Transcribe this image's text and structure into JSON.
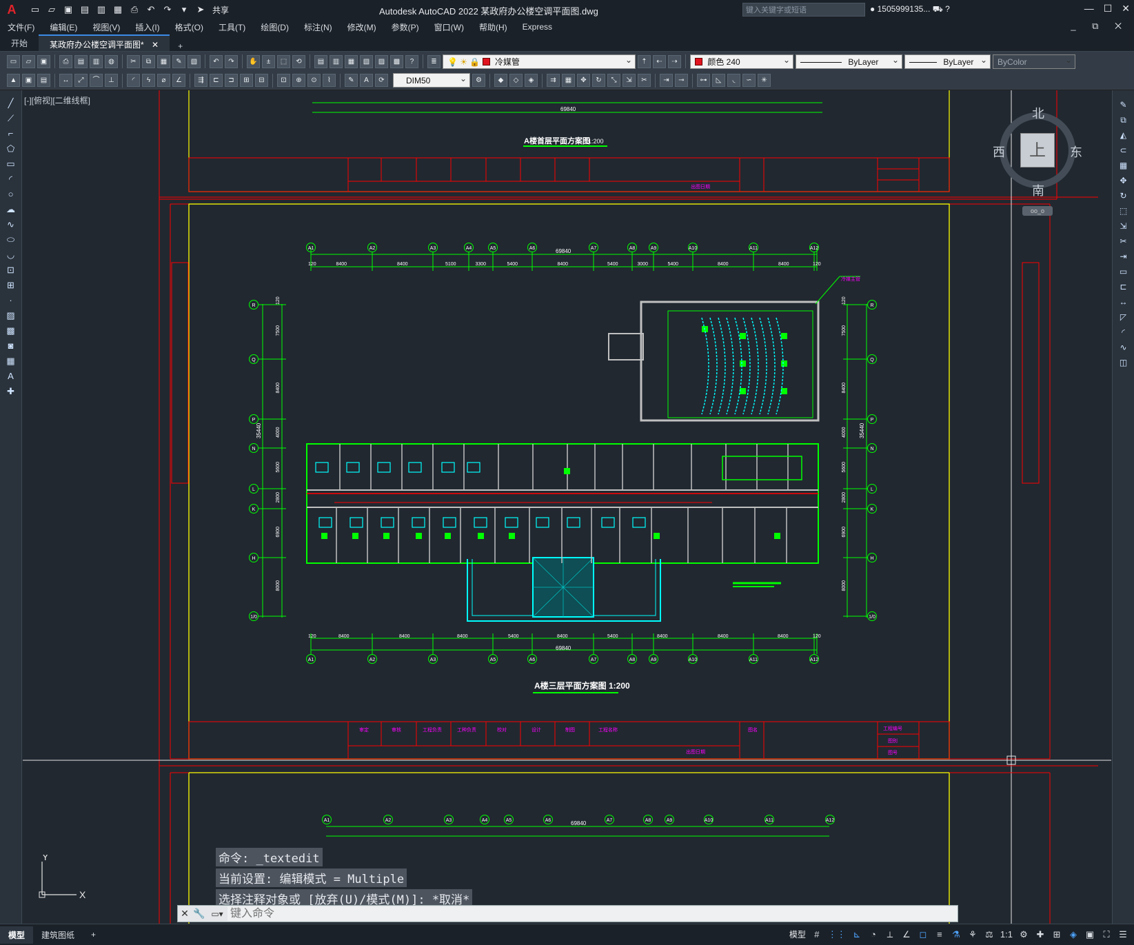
{
  "app": {
    "title": "Autodesk AutoCAD 2022    某政府办公楼空调平面图.dwg",
    "logo": "A",
    "share_label": "共享",
    "search_placeholder": "键入关键字或短语",
    "user": "1505999135...",
    "window_controls": [
      "—",
      "☐",
      "✕"
    ]
  },
  "menu": {
    "items": [
      "文件(F)",
      "编辑(E)",
      "视图(V)",
      "插入(I)",
      "格式(O)",
      "工具(T)",
      "绘图(D)",
      "标注(N)",
      "修改(M)",
      "参数(P)",
      "窗口(W)",
      "帮助(H)",
      "Express"
    ],
    "doc_controls": "_ ⧉ ✕"
  },
  "tabs": {
    "start": "开始",
    "active": "某政府办公楼空调平面图*",
    "close": "✕",
    "add": "+"
  },
  "toolbar": {
    "layer_value": "冷媒管",
    "color_value": "颜色 240",
    "linetype_value": "ByLayer",
    "lineweight_value": "ByLayer",
    "plotstyle_value": "ByColor",
    "dimstyle_value": "DIM50"
  },
  "viewport": {
    "label": "[-][俯视][二维线框]"
  },
  "viewcube": {
    "top": "上",
    "north": "北",
    "south": "南",
    "west": "西",
    "east": "东",
    "wcs": "oo_o"
  },
  "drawing": {
    "title_top": "A楼首层平面方案图",
    "title_top_scale": "1:200",
    "title_mid": "A楼三层平面方案图 1:200",
    "total_dim": "69840",
    "left_dim": "35440",
    "axes_top": [
      "A1",
      "A2",
      "A3",
      "A4",
      "A5",
      "A6",
      "A7",
      "A8",
      "A9",
      "A10",
      "A11",
      "A12"
    ],
    "dims_top": [
      "120",
      "8400",
      "8400",
      "5100",
      "3300",
      "5400",
      "8400",
      "5400",
      "3000",
      "5400",
      "8400",
      "8400",
      "120"
    ],
    "dims_bottom": [
      "120",
      "8400",
      "8400",
      "8400",
      "5400",
      "8400",
      "5400",
      "8400",
      "8400",
      "8400",
      "120"
    ],
    "axes_left": [
      "R",
      "Q",
      "P",
      "N",
      "L",
      "K",
      "H",
      "1/0"
    ],
    "dims_left": [
      "120",
      "7500",
      "8400",
      "4000",
      "5600",
      "2800",
      "6900",
      "8000"
    ],
    "title_block": [
      "审定",
      "审核",
      "工程负责",
      "工种负责",
      "校对",
      "设计",
      "制图",
      "工程名称",
      "图名",
      "工程编号",
      "图别",
      "图号",
      "出图日期"
    ],
    "note": "冷媒主管"
  },
  "command": {
    "history": [
      "命令:  _textedit",
      "当前设置: 编辑模式 = Multiple",
      "选择注释对象或 [放弃(U)/模式(M)]: *取消*"
    ],
    "placeholder": "键入命令"
  },
  "ucs": {
    "x": "X",
    "y": "Y"
  },
  "status": {
    "tabs": [
      "模型",
      "建筑图纸"
    ],
    "add": "+",
    "model": "模型",
    "scale": "1:1"
  },
  "colors": {
    "background": "#212830",
    "frame": "#ffff00",
    "border": "#ff0000",
    "dim": "#00ff00",
    "axis": "#00ff00",
    "equipment": "#00ffff",
    "text": "#ffffff",
    "accent": "#ff00ff"
  }
}
